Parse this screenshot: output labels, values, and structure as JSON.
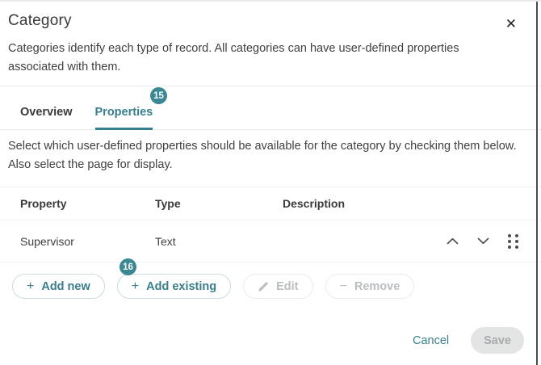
{
  "dialog": {
    "title": "Category",
    "close_glyph": "✕",
    "description": "Categories identify each type of record. All categories can have user-defined properties associated with them.",
    "instruction": "Select which user-defined properties should be available for the category by checking them below. Also select the page for display."
  },
  "tabs": {
    "items": [
      {
        "label": "Overview"
      },
      {
        "label": "Properties"
      }
    ],
    "active_tab": "Properties",
    "properties_badge": "15"
  },
  "table": {
    "columns": [
      "Property",
      "Type",
      "Description"
    ],
    "rows": [
      {
        "property": "Supervisor",
        "type": "Text",
        "description": ""
      }
    ]
  },
  "actions": {
    "add_new_label": "Add new",
    "add_existing_label": "Add existing",
    "add_existing_badge": "16",
    "edit_label": "Edit",
    "remove_label": "Remove",
    "plus_glyph": "+",
    "minus_glyph": "−"
  },
  "footer": {
    "cancel_label": "Cancel",
    "save_label": "Save"
  },
  "colors": {
    "accent_teal": "#37808f",
    "badge_teal": "#3b8895",
    "disabled_text": "#babec0",
    "save_disabled_bg": "#e3e4e4"
  }
}
